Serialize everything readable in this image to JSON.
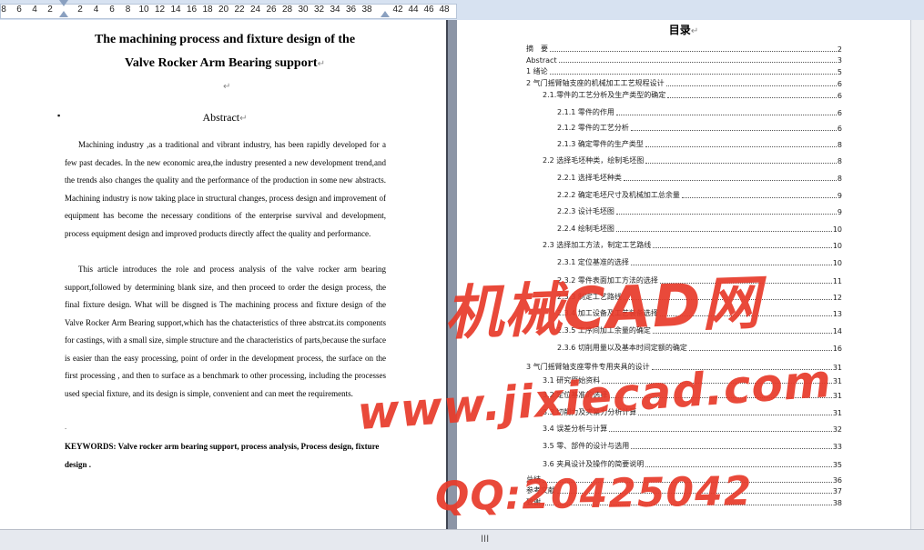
{
  "ruler": {
    "left_ticks": [
      "8",
      "6",
      "4",
      "2"
    ],
    "right_ticks": [
      "2",
      "4",
      "6",
      "8",
      "10",
      "12",
      "14",
      "16",
      "18",
      "20",
      "22",
      "24",
      "26",
      "28",
      "30",
      "32",
      "34",
      "36",
      "38"
    ],
    "far_ticks": [
      "42",
      "44",
      "46",
      "48"
    ]
  },
  "left_page": {
    "title_line1": "The machining process and fixture design of the",
    "title_line2": "Valve Rocker Arm Bearing support",
    "para_mark": "↵",
    "abstract_heading": "Abstract",
    "bullet": "▪",
    "paragraph1": "Machining industry ,as a traditional and vibrant industry, has been rapidly developed for a few past decades. In the new economic area,the industry presented a new development trend,and the trends also changes the quality and the performance of the production in some new abstracts. Machining industry is now taking place in structural changes, process design and improvement of equipment has become the necessary conditions of the enterprise survival and development, process equipment design and improved products directly affect the quality and performance.",
    "paragraph2": "This article introduces the role and process analysis of the valve rocker arm bearing support,followed by determining blank size, and then proceed to order the design process, the final fixture design. What will be disgned is The machining process and fixture design of the Valve Rocker Arm Bearing support,which has the chatacteristics of three abstrcat.its components for castings, with a small size, simple structure and the characteristics of parts,because the surface is easier than the easy processing, point of order in the development process, the surface on the first processing , and then to surface as a benchmark to other processing, including the processes used special fixture, and its design is simple, convenient and can meet the requirements.",
    "small_mark": ".",
    "keywords": "KEYWORDS: Valve rocker arm bearing support, process analysis, Process design, fixture design ."
  },
  "toc": {
    "title": "目录",
    "items": [
      {
        "label": "摘　要",
        "page": "2",
        "indent": 0
      },
      {
        "label": "Abstract",
        "page": "3",
        "indent": 0
      },
      {
        "label": "1  绪论",
        "page": "5",
        "indent": 0
      },
      {
        "label": "2    气门摇臂轴支座的机械加工工艺规程设计",
        "page": "6",
        "indent": 0
      },
      {
        "label": "2.1.零件的工艺分析及生产类型的确定",
        "page": "6",
        "indent": 1
      },
      {
        "label": "2.1.1  零件的作用",
        "page": "6",
        "indent": 2
      },
      {
        "label": "2.1.2  零件的工艺分析",
        "page": "6",
        "indent": 2
      },
      {
        "label": "2.1.3  确定零件的生产类型",
        "page": "8",
        "indent": 2
      },
      {
        "label": "2.2  选择毛坯种类，绘制毛坯图",
        "page": "8",
        "indent": 1
      },
      {
        "label": "2.2.1  选择毛坯种类",
        "page": "8",
        "indent": 2
      },
      {
        "label": "2.2.2 确定毛坯尺寸及机械加工总余量",
        "page": "9",
        "indent": 2
      },
      {
        "label": "2.2.3  设计毛坯图",
        "page": "9",
        "indent": 2
      },
      {
        "label": "2.2.4  绘制毛坯图",
        "page": "10",
        "indent": 2
      },
      {
        "label": "2.3  选择加工方法，制定工艺路线",
        "page": "10",
        "indent": 1
      },
      {
        "label": "2.3.1  定位基准的选择",
        "page": "10",
        "indent": 2
      },
      {
        "label": "2.3.2  零件表面加工方法的选择",
        "page": "11",
        "indent": 2
      },
      {
        "label": "2.3.3  制定工艺路线",
        "page": "12",
        "indent": 2
      },
      {
        "label": "2.3.4  加工设备及工艺装备选择",
        "page": "13",
        "indent": 2
      },
      {
        "label": "2.3.5  工序间加工余量的确定",
        "page": "14",
        "indent": 2
      },
      {
        "label": "2.3.6 切削用量以及基本时间定额的确定",
        "page": "16",
        "indent": 2
      },
      {
        "label": "3  气门摇臂轴支座零件专用夹具的设计",
        "page": "31",
        "indent": 0
      },
      {
        "label": "3.1  研究原始资料",
        "page": "31",
        "indent": 1
      },
      {
        "label": "3.2  定位基准的选择",
        "page": "31",
        "indent": 1
      },
      {
        "label": "3.3  切削力及夹紧力分析计算",
        "page": "31",
        "indent": 1
      },
      {
        "label": "3.4  误差分析与计算",
        "page": "32",
        "indent": 1
      },
      {
        "label": "3.5  零、部件的设计与选用",
        "page": "33",
        "indent": 1
      },
      {
        "label": "3.6  夹具设计及操作的简要说明",
        "page": "35",
        "indent": 1
      },
      {
        "label": "总结",
        "page": "36",
        "indent": 0
      },
      {
        "label": "参考文献",
        "page": "37",
        "indent": 0
      },
      {
        "label": "致谢",
        "page": "38",
        "indent": 0
      }
    ]
  },
  "watermark": {
    "line1": "机械CAD网",
    "line2": "www.jixiecad.com",
    "line3": "QQ:20425042",
    "color": "#e83a2a"
  },
  "scrollbar": {
    "grip": "III"
  }
}
